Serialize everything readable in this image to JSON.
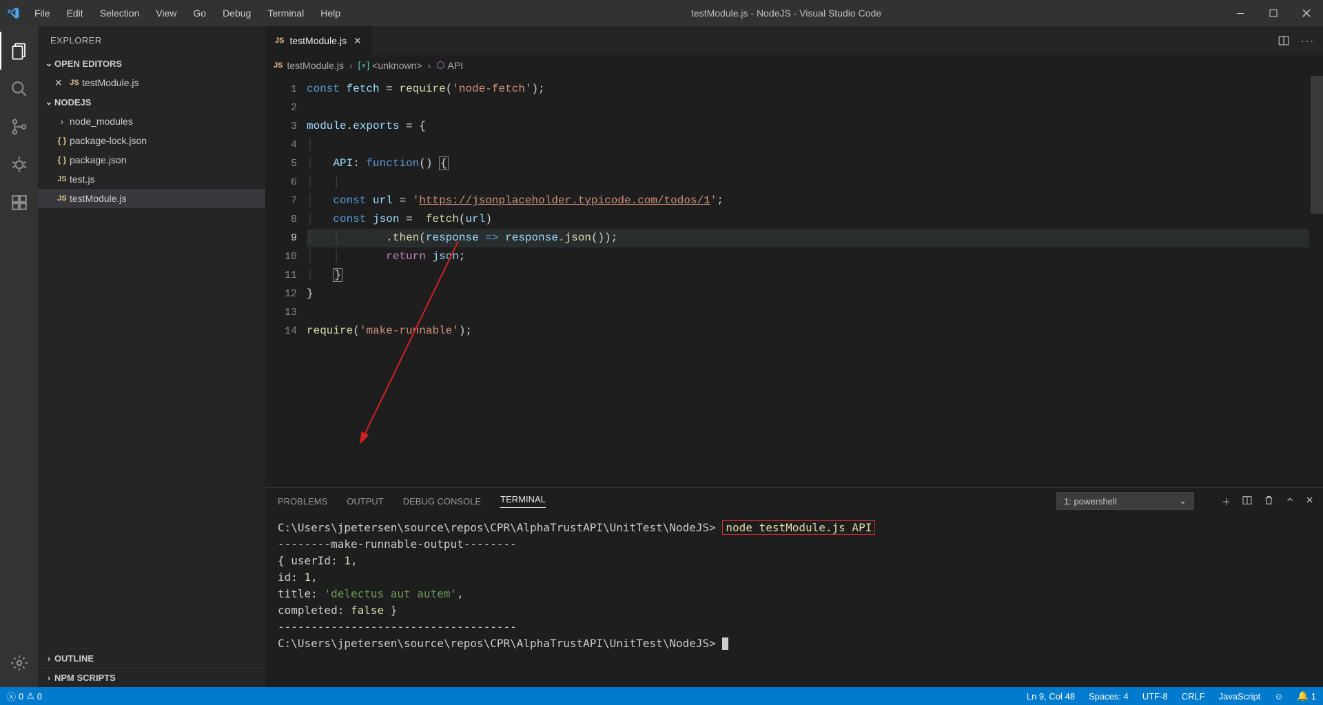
{
  "titlebar": {
    "title": "testModule.js - NodeJS - Visual Studio Code",
    "menus": [
      "File",
      "Edit",
      "Selection",
      "View",
      "Go",
      "Debug",
      "Terminal",
      "Help"
    ]
  },
  "activity": {
    "icons": [
      "files",
      "search",
      "source-control",
      "debug",
      "extensions"
    ],
    "bottom": [
      "gear"
    ]
  },
  "sidebar": {
    "title": "EXPLORER",
    "open_editors_label": "OPEN EDITORS",
    "open_editors": [
      {
        "name": "testModule.js",
        "icon": "JS"
      }
    ],
    "project_label": "NODEJS",
    "files": [
      {
        "name": "node_modules",
        "type": "folder"
      },
      {
        "name": "package-lock.json",
        "type": "json"
      },
      {
        "name": "package.json",
        "type": "json"
      },
      {
        "name": "test.js",
        "type": "js"
      },
      {
        "name": "testModule.js",
        "type": "js",
        "selected": true
      }
    ],
    "outline_label": "OUTLINE",
    "npm_scripts_label": "NPM SCRIPTS"
  },
  "tab": {
    "label": "testModule.js"
  },
  "breadcrumbs": {
    "file": "testModule.js",
    "symbol1": "<unknown>",
    "symbol2": "API"
  },
  "code_lines": [
    {
      "n": 1,
      "html": "<span class='kw-blue'>const</span> <span class='kw-lightblue'>fetch</span> <span class='kw-punct'>=</span> <span class='kw-fn'>require</span><span class='kw-punct'>(</span><span class='kw-str'>'node-fetch'</span><span class='kw-punct'>);</span>"
    },
    {
      "n": 2,
      "html": ""
    },
    {
      "n": 3,
      "html": "<span class='kw-lightblue'>module</span><span class='kw-punct'>.</span><span class='kw-lightblue'>exports</span> <span class='kw-punct'>=</span> <span class='kw-punct'>{</span>"
    },
    {
      "n": 4,
      "html": "<span class='indent-guide'>│</span>"
    },
    {
      "n": 5,
      "html": "<span class='indent-guide'>│</span>   <span class='kw-lightblue'>API</span><span class='kw-punct'>:</span> <span class='kw-blue'>function</span><span class='kw-punct'>()</span> <span class='bracket-box'>{</span>"
    },
    {
      "n": 6,
      "html": "<span class='indent-guide'>│</span>   <span class='indent-guide'>│</span>"
    },
    {
      "n": 7,
      "html": "<span class='indent-guide'>│</span>   <span class='kw-blue'>const</span> <span class='kw-lightblue'>url</span> <span class='kw-punct'>=</span> <span class='kw-str'>'</span><span class='kw-url'>https://jsonplaceholder.typicode.com/todos/1</span><span class='kw-str'>'</span><span class='kw-punct'>;</span>"
    },
    {
      "n": 8,
      "html": "<span class='indent-guide'>│</span>   <span class='kw-blue'>const</span> <span class='kw-lightblue'>json</span> <span class='kw-punct'>=</span>  <span class='kw-fn'>fetch</span><span class='kw-punct'>(</span><span class='kw-lightblue'>url</span><span class='kw-punct'>)</span>"
    },
    {
      "n": 9,
      "html": "<span class='indent-guide'>│</span>   <span class='indent-guide'>│</span>       <span class='kw-punct'>.</span><span class='kw-fn'>then</span><span class='kw-punct'>(</span><span class='kw-lightblue'>response</span> <span class='kw-blue'>=&gt;</span> <span class='kw-lightblue'>response</span><span class='kw-punct'>.</span><span class='kw-fn'>json</span><span class='kw-punct'>());</span>",
      "current": true
    },
    {
      "n": 10,
      "html": "<span class='indent-guide'>│</span>   <span class='indent-guide'>│</span>       <span class='kw-pink'>return</span> <span class='kw-lightblue'>json</span><span class='kw-punct'>;</span>"
    },
    {
      "n": 11,
      "html": "<span class='indent-guide'>│</span>   <span class='bracket-box'>}</span>"
    },
    {
      "n": 12,
      "html": "<span class='kw-punct'>}</span>"
    },
    {
      "n": 13,
      "html": ""
    },
    {
      "n": 14,
      "html": "<span class='kw-fn'>require</span><span class='kw-punct'>(</span><span class='kw-str'>'make-runnable'</span><span class='kw-punct'>);</span>"
    }
  ],
  "panel": {
    "tabs": [
      "PROBLEMS",
      "OUTPUT",
      "DEBUG CONSOLE",
      "TERMINAL"
    ],
    "active_tab": "TERMINAL",
    "terminal_selector": "1: powershell",
    "prompt_path": "C:\\Users\\jpetersen\\source\\repos\\CPR\\AlphaTrustAPI\\UnitTest\\NodeJS>",
    "command": "node testModule.js API",
    "output_header": "--------make-runnable-output--------",
    "output_obj_open": "{ userId: ",
    "output_userId": "1",
    "output_comma1": ",",
    "output_id_label": "  id: ",
    "output_id": "1",
    "output_comma2": ",",
    "output_title_label": "  title: ",
    "output_title_val": "'delectus aut autem'",
    "output_comma3": ",",
    "output_completed_label": "  completed: ",
    "output_completed_val": "false",
    "output_obj_close": " }",
    "output_footer": "------------------------------------"
  },
  "statusbar": {
    "errors": "0",
    "warnings": "0",
    "line_col": "Ln 9, Col 48",
    "spaces": "Spaces: 4",
    "encoding": "UTF-8",
    "eol": "CRLF",
    "language": "JavaScript",
    "bell_count": "1"
  }
}
